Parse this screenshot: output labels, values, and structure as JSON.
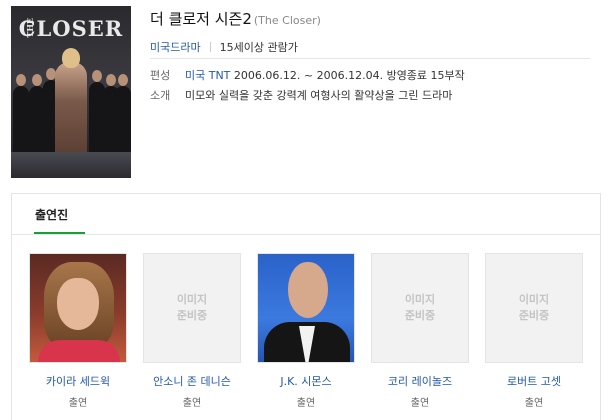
{
  "poster": {
    "title_small": "THE",
    "title_big": "CLOSER"
  },
  "show": {
    "title": "더 클로저 시즌2",
    "original_title": "(The Closer)",
    "category": "미국드라마",
    "rating": "15세이상 관람가"
  },
  "info": {
    "broadcast_label": "편성",
    "broadcast_network": "미국 TNT",
    "broadcast_details": "2006.06.12. ~ 2006.12.04. 방영종료 15부작",
    "summary_label": "소개",
    "summary": "미모와 실력을 갖춘 강력계 여형사의 활약상을 그린 드라마"
  },
  "cast_section": {
    "tab_label": "출연진",
    "placeholder_line1": "이미지",
    "placeholder_line2": "준비중",
    "members": [
      {
        "name": "카이라 세드윅",
        "role": "출연",
        "has_photo": true
      },
      {
        "name": "안소니 존 데니슨",
        "role": "출연",
        "has_photo": false
      },
      {
        "name": "J.K. 시몬스",
        "role": "출연",
        "has_photo": true
      },
      {
        "name": "코리 레이놀즈",
        "role": "출연",
        "has_photo": false
      },
      {
        "name": "로버트 고셋",
        "role": "출연",
        "has_photo": false
      }
    ]
  },
  "colors": {
    "link": "#2358a8",
    "tab_accent": "#1a9e3a"
  }
}
